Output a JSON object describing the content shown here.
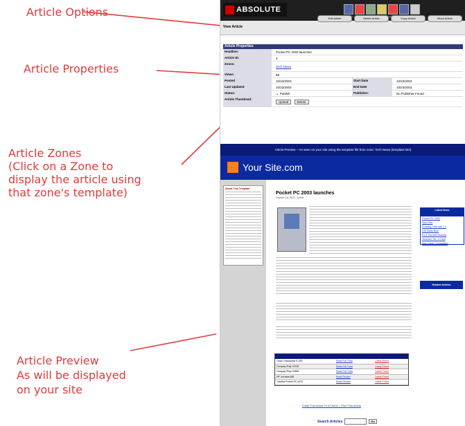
{
  "callouts": {
    "article_options": "Article Options",
    "article_properties": "Article Properties",
    "article_zones": "Article Zones\n(Click on a Zone to\ndisplay the article using\nthat zone's template)",
    "article_preview": "Article Preview\nAs will be displayed\non your site"
  },
  "colors": {
    "callout": "#e23a3a",
    "header_blue": "#333a7a",
    "site_blue": "#0b2aa0",
    "accent_orange": "#f58220"
  },
  "app": {
    "logo": "ABSOLUTE",
    "view_article": "View Article",
    "top_links": "Search · Switch · Users · Views · Plugins · Options · Log Out"
  },
  "options": [
    "Edit Article",
    "Delete Article",
    "Copy Article",
    "Move Article"
  ],
  "properties": {
    "header": "Article Properties",
    "rows": [
      {
        "label": "Headline:",
        "value": "Pocket PC 2003 launches"
      },
      {
        "label": "Article ID:",
        "value": "4"
      },
      {
        "label": "Zones:",
        "value": "Tech News"
      },
      {
        "label": "Views:",
        "value": "59"
      },
      {
        "label": "Posted",
        "value": "10/23/2003"
      },
      {
        "label": "Last Updated",
        "value": "10/23/2003"
      },
      {
        "label": "Status:",
        "value": "Publish"
      },
      {
        "label": "Article Thumbnail:",
        "value": ""
      }
    ],
    "start_date_label": "Start Date",
    "start_date": "10/23/2003",
    "end_date_label": "End Date",
    "end_date": "10/23/2003",
    "publisher_label": "Publisher:",
    "publisher": "No Publisher Found",
    "upload_label": "Upload",
    "delete_label": "Delete"
  },
  "preview": {
    "strip_text": "Article Preview -- As seen on your site using the template file from zone: Tech News (template.htm)",
    "site_title": "Your Site.com",
    "headline": "Pocket PC 2003 launches",
    "byline": "October 1st 2003 :: Admin",
    "sidebar_title": "About This Template",
    "latest_news_header": "Latest News",
    "latest_news": [
      "Pocket PC 2003",
      "Save Box",
      "Running, Hits with 1.2",
      "Gift Static Rule",
      "Do it Yourself Security",
      "Jamcam, Oh, a Cleat",
      "Mac Cable Comparison"
    ],
    "related_header": "Related Articles",
    "email_link": "Email This Article To A Friend :: Print This Article",
    "search_label": "Search Articles",
    "search_go": "Go",
    "table_rows": [
      {
        "name": "Casio Cassiopeia E-200",
        "review": "Read Full Tuba",
        "price": "Latest Prices"
      },
      {
        "name": "Compaq iPaq H3760",
        "review": "Read Full Tuba",
        "price": "Latest Prices"
      },
      {
        "name": "Compaq iPaq H3850",
        "review": "Read Full Tuba",
        "price": "Latest Prices"
      },
      {
        "name": "HP Jornada 568",
        "review": "Read Review",
        "price": "Latest Prices"
      },
      {
        "name": "Toshiba Pocket PC e570",
        "review": "Read Review",
        "price": "Latest Prices"
      }
    ]
  }
}
